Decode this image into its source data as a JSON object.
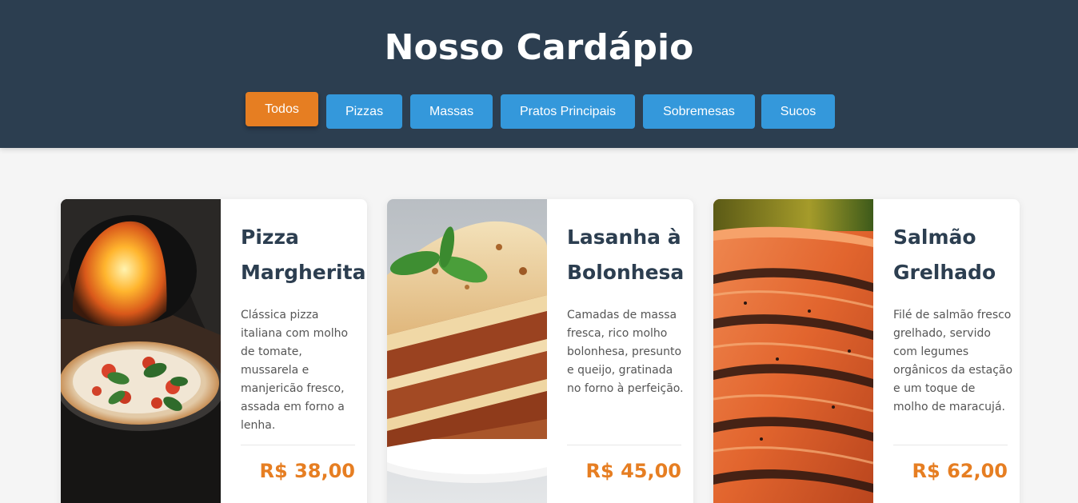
{
  "header": {
    "title": "Nosso Cardápio"
  },
  "filters": [
    {
      "label": "Todos",
      "active": true
    },
    {
      "label": "Pizzas",
      "active": false
    },
    {
      "label": "Massas",
      "active": false
    },
    {
      "label": "Pratos Principais",
      "active": false
    },
    {
      "label": "Sobremesas",
      "active": false
    },
    {
      "label": "Sucos",
      "active": false
    }
  ],
  "menu_items": [
    {
      "title": "Pizza Margherita",
      "description": "Clássica pizza italiana com molho de tomate, mussarela e manjericão fresco, assada em forno a lenha.",
      "price": "R$ 38,00",
      "image": "pizza-photo"
    },
    {
      "title": "Lasanha à Bolonhesa",
      "description": "Camadas de massa fresca, rico molho bolonhesa, presunto e queijo, gratinada no forno à perfeição.",
      "price": "R$ 45,00",
      "image": "lasagna-photo"
    },
    {
      "title": "Salmão Grelhado",
      "description": "Filé de salmão fresco grelhado, servido com legumes orgânicos da estação e um toque de molho de maracujá.",
      "price": "R$ 62,00",
      "image": "salmon-photo"
    }
  ],
  "colors": {
    "header_bg": "#2c3e50",
    "button_blue": "#3498db",
    "accent_orange": "#e67e22"
  }
}
